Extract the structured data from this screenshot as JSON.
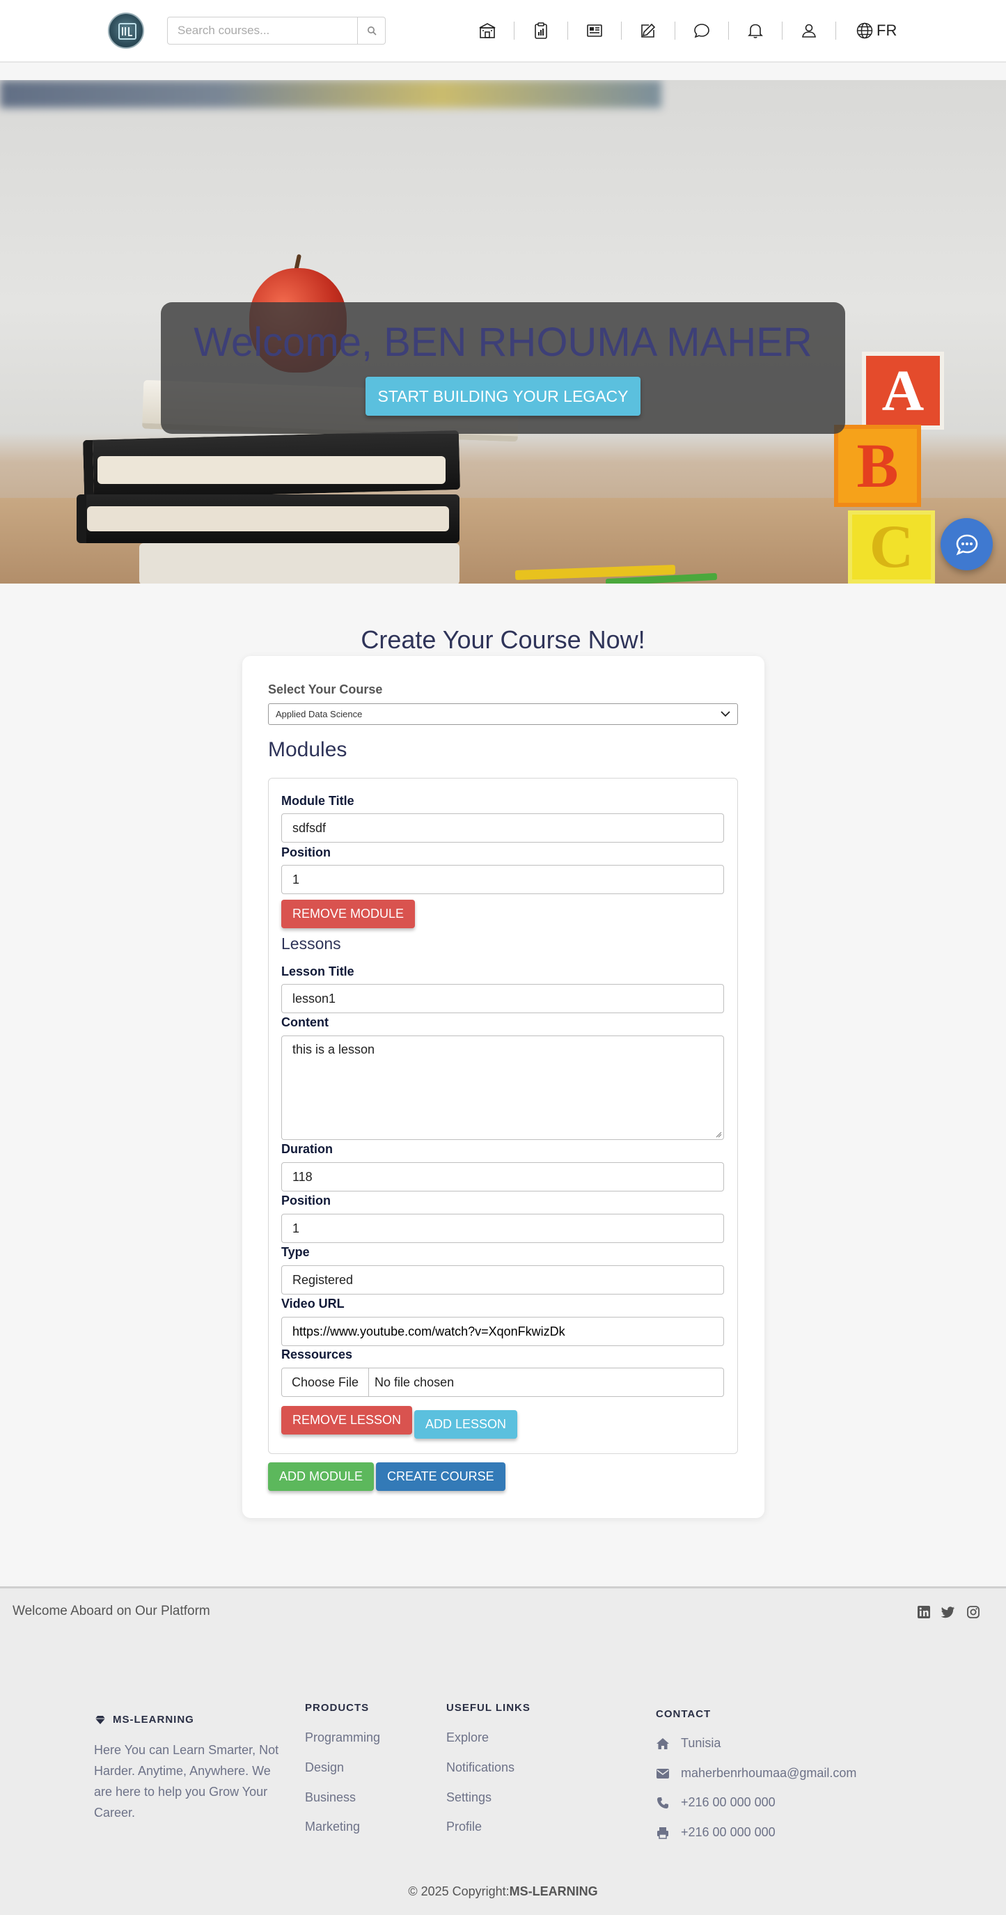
{
  "navbar": {
    "search_placeholder": "Search courses...",
    "icons": [
      "school-icon",
      "clipboard-icon",
      "newspaper-icon",
      "edit-icon",
      "chat-icon",
      "bell-icon",
      "user-icon",
      "globe-icon"
    ],
    "lang_label": "FR"
  },
  "hero": {
    "title": "Welcome, BEN RHOUMA MAHER",
    "cta_label": "START BUILDING YOUR LEGACY",
    "blocks": [
      "A",
      "B",
      "C"
    ]
  },
  "form": {
    "heading": "Create Your Course Now!",
    "select_label": "Select Your Course",
    "select_value": "Applied Data Science",
    "modules_heading": "Modules",
    "module": {
      "title_label": "Module Title",
      "title_value": "sdfsdf",
      "position_label": "Position",
      "position_value": "1",
      "remove_label": "REMOVE MODULE"
    },
    "lessons_heading": "Lessons",
    "lesson": {
      "title_label": "Lesson Title",
      "title_value": "lesson1",
      "content_label": "Content",
      "content_value": "this is a lesson",
      "duration_label": "Duration",
      "duration_value": "118",
      "position_label": "Position",
      "position_value": "1",
      "type_label": "Type",
      "type_value": "Registered",
      "video_label": "Video URL",
      "video_value": "https://www.youtube.com/watch?v=XqonFkwizDk",
      "resources_label": "Ressources",
      "file_button": "Choose File",
      "file_status": "No file chosen",
      "remove_label": "REMOVE LESSON",
      "add_label": "ADD LESSON"
    },
    "add_module_label": "ADD MODULE",
    "create_course_label": "CREATE COURSE"
  },
  "footer": {
    "welcome": "Welcome Aboard on Our Platform",
    "social": [
      "linkedin-icon",
      "twitter-icon",
      "instagram-icon"
    ],
    "brand": "MS-LEARNING",
    "description": "Here You can Learn Smarter, Not Harder. Anytime, Anywhere. We are here to help you Grow Your Career.",
    "products_heading": "PRODUCTS",
    "products": [
      "Programming",
      "Design",
      "Business",
      "Marketing"
    ],
    "useful_heading": "USEFUL LINKS",
    "useful": [
      "Explore",
      "Notifications",
      "Settings",
      "Profile"
    ],
    "contact_heading": "CONTACT",
    "contact": {
      "location": "Tunisia",
      "email": "maherbenrhoumaa@gmail.com",
      "phone": "+216 00 000 000",
      "fax": "+216 00 000 000"
    },
    "copyright_prefix": "© 2025 Copyright:",
    "copyright_brand": "MS-LEARNING"
  },
  "colors": {
    "accent_cyan": "#5bc0de",
    "danger": "#d9534f",
    "success": "#5cb85c",
    "primary": "#337ab7",
    "heading": "#2f3459",
    "chat_fab": "#3f79d0"
  }
}
